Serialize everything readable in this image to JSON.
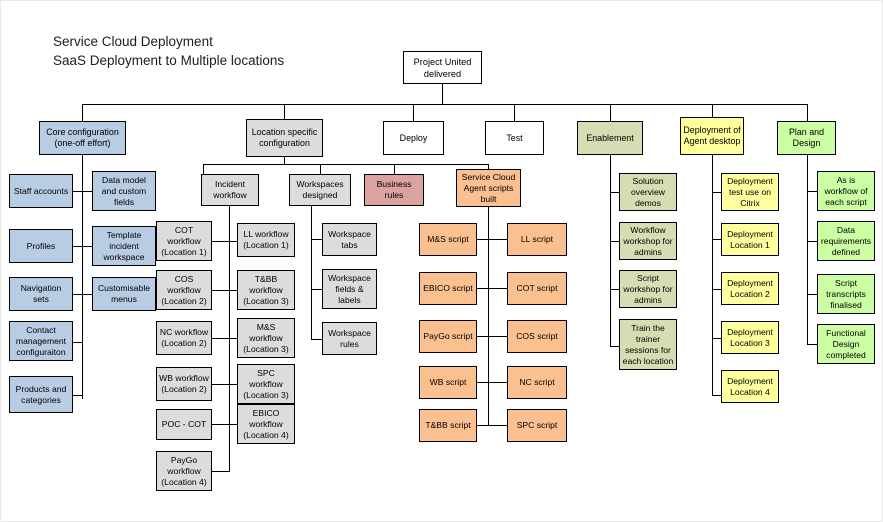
{
  "title": {
    "line1": "Service Cloud Deployment",
    "line2": "SaaS Deployment to Multiple locations"
  },
  "colors": {
    "white": "#ffffff",
    "blue": "#b8cce4",
    "grey": "#dcdcdc",
    "red": "#dba3a0",
    "orange": "#fac090",
    "olive": "#d5ddb3",
    "yellow": "#ffff9e",
    "green": "#ccffa3",
    "line": "#000000"
  },
  "root": {
    "label": "Project United delivered"
  },
  "level1": [
    {
      "label": "Core configuration (one-off effort)"
    },
    {
      "label": "Location specific configuration"
    },
    {
      "label": "Deploy"
    },
    {
      "label": "Test"
    },
    {
      "label": "Enablement"
    },
    {
      "label": "Deployment of Agent desktop"
    },
    {
      "label": "Plan and Design"
    }
  ],
  "core_configuration": {
    "left": [
      {
        "label": "Staff accounts"
      },
      {
        "label": "Profiles"
      },
      {
        "label": "Navigation sets"
      },
      {
        "label": "Contact management configuraiton"
      },
      {
        "label": "Products and categories"
      }
    ],
    "right": [
      {
        "label": "Data model and custom fields"
      },
      {
        "label": "Template incident workspace"
      },
      {
        "label": "Customisable menus"
      }
    ]
  },
  "location_specific": {
    "children": [
      {
        "label": "Incident workflow"
      },
      {
        "label": "Workspaces designed"
      },
      {
        "label": "Business rules"
      },
      {
        "label": "Service Cloud Agent scripts built"
      }
    ]
  },
  "incident_workflow": {
    "left": [
      {
        "label": "COT workflow (Location 1)"
      },
      {
        "label": "COS workflow (Location 2)"
      },
      {
        "label": "NC workflow (Location 2)"
      },
      {
        "label": "WB workflow (Location 2)"
      },
      {
        "label": "POC - COT"
      },
      {
        "label": "PayGo workflow (Location 4)"
      }
    ],
    "right": [
      {
        "label": "LL workflow (Location 1)"
      },
      {
        "label": "T&BB workflow (Location 3)"
      },
      {
        "label": "M&S workflow (Location 3)"
      },
      {
        "label": "SPC workflow (Location 3)"
      },
      {
        "label": "EBICO workflow (Location 4)"
      }
    ]
  },
  "workspaces_designed": {
    "children": [
      {
        "label": "Workspace tabs"
      },
      {
        "label": "Workspace fields & labels"
      },
      {
        "label": "Workspace rules"
      }
    ]
  },
  "agent_scripts": {
    "left": [
      {
        "label": "M&S script"
      },
      {
        "label": "EBICO script"
      },
      {
        "label": "PayGo script"
      },
      {
        "label": "WB script"
      },
      {
        "label": "T&BB script"
      }
    ],
    "right": [
      {
        "label": "LL script"
      },
      {
        "label": "COT script"
      },
      {
        "label": "COS script"
      },
      {
        "label": "NC script"
      },
      {
        "label": "SPC script"
      }
    ]
  },
  "enablement": {
    "children": [
      {
        "label": "Solution overview demos"
      },
      {
        "label": "Workflow workshop for admins"
      },
      {
        "label": "Script workshop for admins"
      },
      {
        "label": "Train the trainer sessions for each location"
      }
    ]
  },
  "agent_desktop": {
    "children": [
      {
        "label": "Deployment test use on Citrix"
      },
      {
        "label": "Deployment Location 1"
      },
      {
        "label": "Deployment Location 2"
      },
      {
        "label": "Deployment Location 3"
      },
      {
        "label": "Deployment Location 4"
      }
    ]
  },
  "plan_and_design": {
    "children": [
      {
        "label": "As is workflow of each script"
      },
      {
        "label": "Data requirements defined"
      },
      {
        "label": "Script transcripts finalised"
      },
      {
        "label": "Functional Design completed"
      }
    ]
  }
}
